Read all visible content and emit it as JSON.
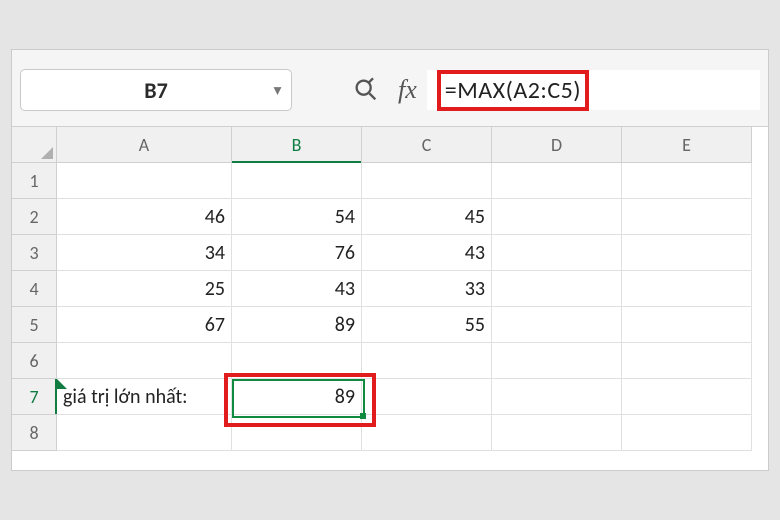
{
  "name_box": "B7",
  "formula": "=MAX(A2:C5)",
  "columns": [
    "A",
    "B",
    "C",
    "D",
    "E"
  ],
  "active_column_index": 1,
  "rows": [
    1,
    2,
    3,
    4,
    5,
    6,
    7,
    8
  ],
  "active_row_index": 6,
  "cells": {
    "r2": {
      "A": "46",
      "B": "54",
      "C": "45"
    },
    "r3": {
      "A": "34",
      "B": "76",
      "C": "43"
    },
    "r4": {
      "A": "25",
      "B": "43",
      "C": "33"
    },
    "r5": {
      "A": "67",
      "B": "89",
      "C": "55"
    },
    "r7": {
      "A": "giá trị lớn nhất:",
      "B": "89"
    }
  },
  "icons": {
    "zoom": "zoom-lens-icon",
    "fx": "fx"
  }
}
